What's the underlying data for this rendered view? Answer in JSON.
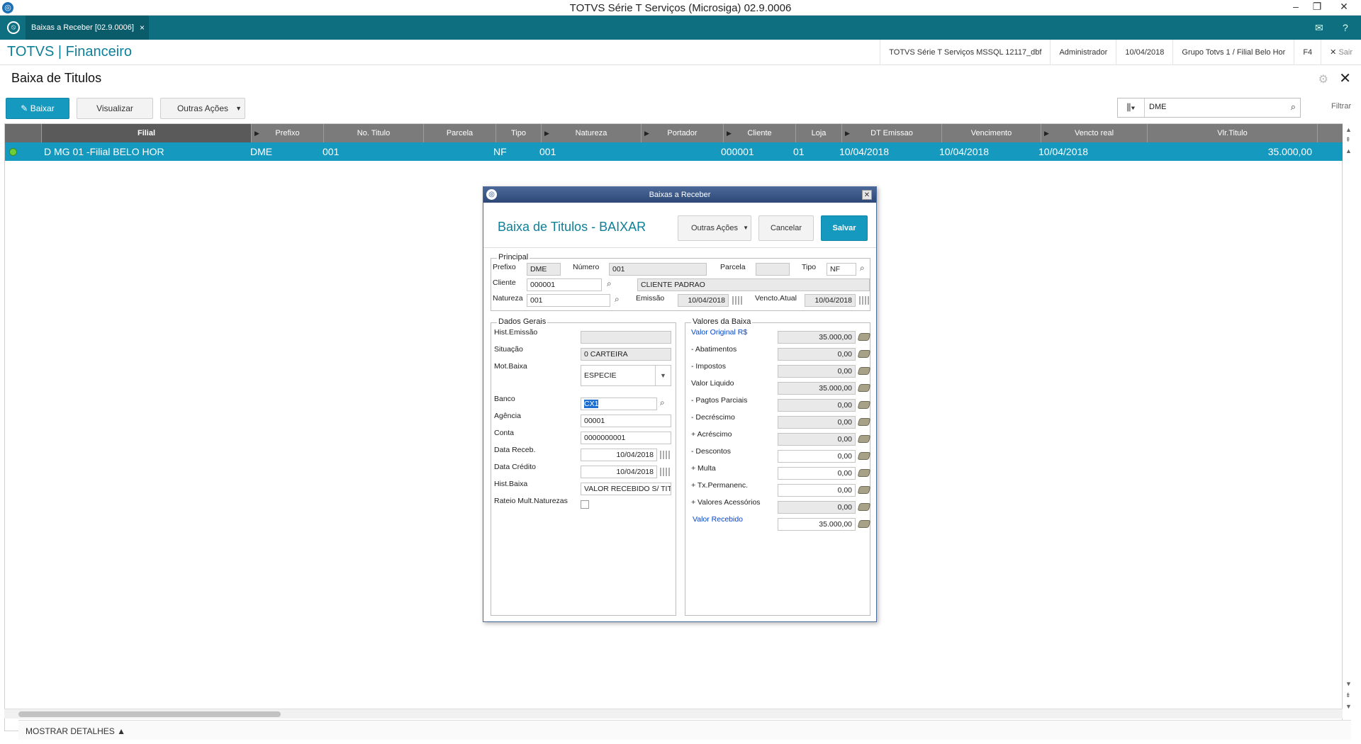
{
  "window": {
    "title": "TOTVS Série T Serviços (Microsiga) 02.9.0006"
  },
  "tab": {
    "label": "Baixas a Receber [02.9.0006]",
    "close": "×"
  },
  "app": {
    "brand": "TOTVS | Financeiro",
    "env": "TOTVS Série T Serviços MSSQL 12117_dbf",
    "user": "Administrador",
    "date": "10/04/2018",
    "branch": "Grupo Totvs 1 / Filial Belo Hor",
    "shortcut": "F4",
    "logout": "Sair"
  },
  "page": {
    "title": "Baixa de Titulos"
  },
  "toolbar": {
    "baixar": "Baixar",
    "visualizar": "Visualizar",
    "outras": "Outras Ações"
  },
  "search": {
    "value": "DME",
    "filter": "Filtrar"
  },
  "grid": {
    "columns": [
      "Filial",
      "Prefixo",
      "No. Titulo",
      "Parcela",
      "Tipo",
      "Natureza",
      "Portador",
      "Cliente",
      "Loja",
      "DT Emissao",
      "Vencimento",
      "Vencto real",
      "Vlr.Titulo"
    ],
    "row": {
      "filial": "D MG 01 -Filial BELO HOR",
      "prefixo": "DME",
      "numero": "001",
      "parcela": "",
      "tipo": "NF",
      "natureza": "001",
      "portador": "",
      "cliente": "000001",
      "loja": "01",
      "emissao": "10/04/2018",
      "vencimento": "10/04/2018",
      "vencto_real": "10/04/2018",
      "valor": "35.000,00"
    }
  },
  "footer": {
    "details": "MOSTRAR DETALHES ▲"
  },
  "modal": {
    "window_title": "Baixas a Receber",
    "heading": "Baixa de Titulos - BAIXAR",
    "btn_outras": "Outras Ações",
    "btn_cancelar": "Cancelar",
    "btn_salvar": "Salvar",
    "principal": {
      "legend": "Principal",
      "prefixo_lbl": "Prefixo",
      "prefixo": "DME",
      "numero_lbl": "Número",
      "numero": "001",
      "parcela_lbl": "Parcela",
      "parcela": "",
      "tipo_lbl": "Tipo",
      "tipo": "NF",
      "cliente_lbl": "Cliente",
      "cliente": "000001",
      "cliente_nome": "CLIENTE PADRAO",
      "natureza_lbl": "Natureza",
      "natureza": "001",
      "emissao_lbl": "Emissão",
      "emissao": "10/04/2018",
      "vencto_lbl": "Vencto.Atual",
      "vencto": "10/04/2018"
    },
    "gerais": {
      "legend": "Dados Gerais",
      "hist_emissao_lbl": "Hist.Emissão",
      "hist_emissao": "",
      "situacao_lbl": "Situação",
      "situacao": "0 CARTEIRA",
      "mot_lbl": "Mot.Baixa",
      "mot": "ESPECIE",
      "banco_lbl": "Banco",
      "banco": "CX1",
      "agencia_lbl": "Agência",
      "agencia": "00001",
      "conta_lbl": "Conta",
      "conta": "0000000001",
      "data_receb_lbl": "Data Receb.",
      "data_receb": "10/04/2018",
      "data_credito_lbl": "Data Crédito",
      "data_credito": "10/04/2018",
      "hist_baixa_lbl": "Hist.Baixa",
      "hist_baixa": "VALOR RECEBIDO S/ TIT",
      "rateio_lbl": "Rateio Mult.Naturezas"
    },
    "valores": {
      "legend": "Valores da Baixa",
      "items": [
        {
          "label": "Valor Original R$",
          "value": "35.000,00"
        },
        {
          "label": "- Abatimentos",
          "value": "0,00"
        },
        {
          "label": "- Impostos",
          "value": "0,00"
        },
        {
          "label": "Valor Liquido",
          "value": "35.000,00"
        },
        {
          "label": "- Pagtos Parciais",
          "value": "0,00"
        },
        {
          "label": "- Decréscimo",
          "value": "0,00"
        },
        {
          "label": "+ Acréscimo",
          "value": "0,00"
        },
        {
          "label": "- Descontos",
          "value": "0,00"
        },
        {
          "label": "+ Multa",
          "value": "0,00"
        },
        {
          "label": "+ Tx.Permanenc.",
          "value": "0,00"
        },
        {
          "label": "+ Valores Acessórios",
          "value": "0,00"
        },
        {
          "label": "Valor Recebido",
          "value": "35.000,00"
        }
      ]
    }
  }
}
